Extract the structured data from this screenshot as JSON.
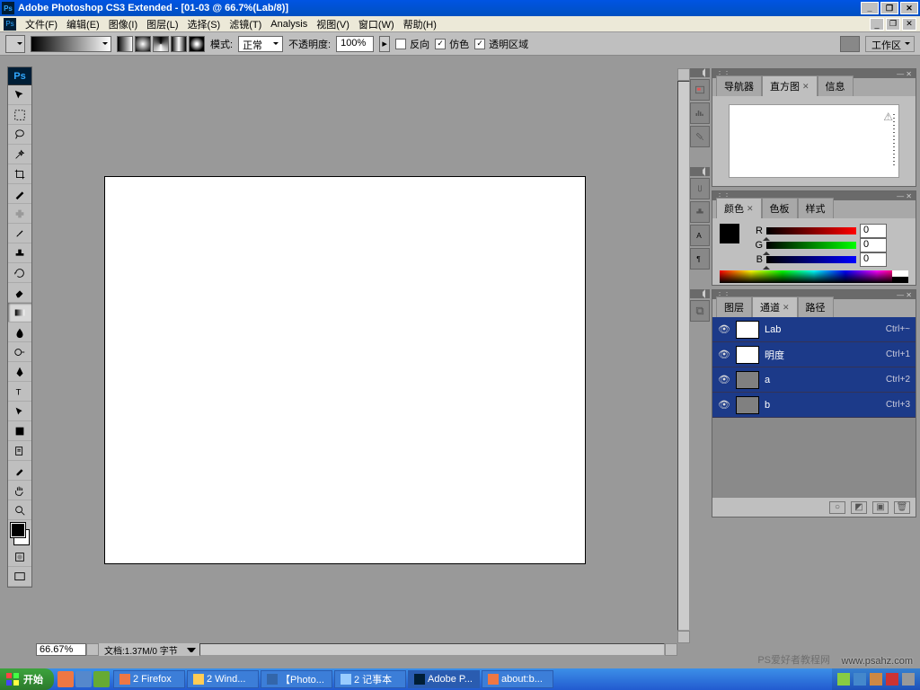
{
  "title": "Adobe Photoshop CS3 Extended - [01-03 @ 66.7%(Lab/8)]",
  "menu": [
    "文件(F)",
    "编辑(E)",
    "图像(I)",
    "图层(L)",
    "选择(S)",
    "滤镜(T)",
    "Analysis",
    "视图(V)",
    "窗口(W)",
    "帮助(H)"
  ],
  "options": {
    "mode_label": "模式:",
    "mode_value": "正常",
    "opacity_label": "不透明度:",
    "opacity_value": "100%",
    "reverse": "反向",
    "dither": "仿色",
    "transparency": "透明区域",
    "workspace": "工作区"
  },
  "navigator": {
    "tabs": [
      "导航器",
      "直方图",
      "信息"
    ]
  },
  "color": {
    "tabs": [
      "颜色",
      "色板",
      "样式"
    ],
    "r_label": "R",
    "g_label": "G",
    "b_label": "B",
    "r": "0",
    "g": "0",
    "b": "0"
  },
  "channels": {
    "tabs": [
      "图层",
      "通道",
      "路径"
    ],
    "rows": [
      {
        "name": "Lab",
        "shortcut": "Ctrl+~",
        "gray": false
      },
      {
        "name": "明度",
        "shortcut": "Ctrl+1",
        "gray": false
      },
      {
        "name": "a",
        "shortcut": "Ctrl+2",
        "gray": true
      },
      {
        "name": "b",
        "shortcut": "Ctrl+3",
        "gray": true
      }
    ]
  },
  "status": {
    "zoom": "66.67%",
    "doc_info": "文档:1.37M/0 字节"
  },
  "taskbar": {
    "start": "开始",
    "tasks": [
      "2 Wind...",
      "【Photo...",
      "2 记事本",
      "Adobe P...",
      "about:b..."
    ]
  },
  "watermark1": "PS爱好者教程网",
  "watermark2": "www.psahz.com"
}
